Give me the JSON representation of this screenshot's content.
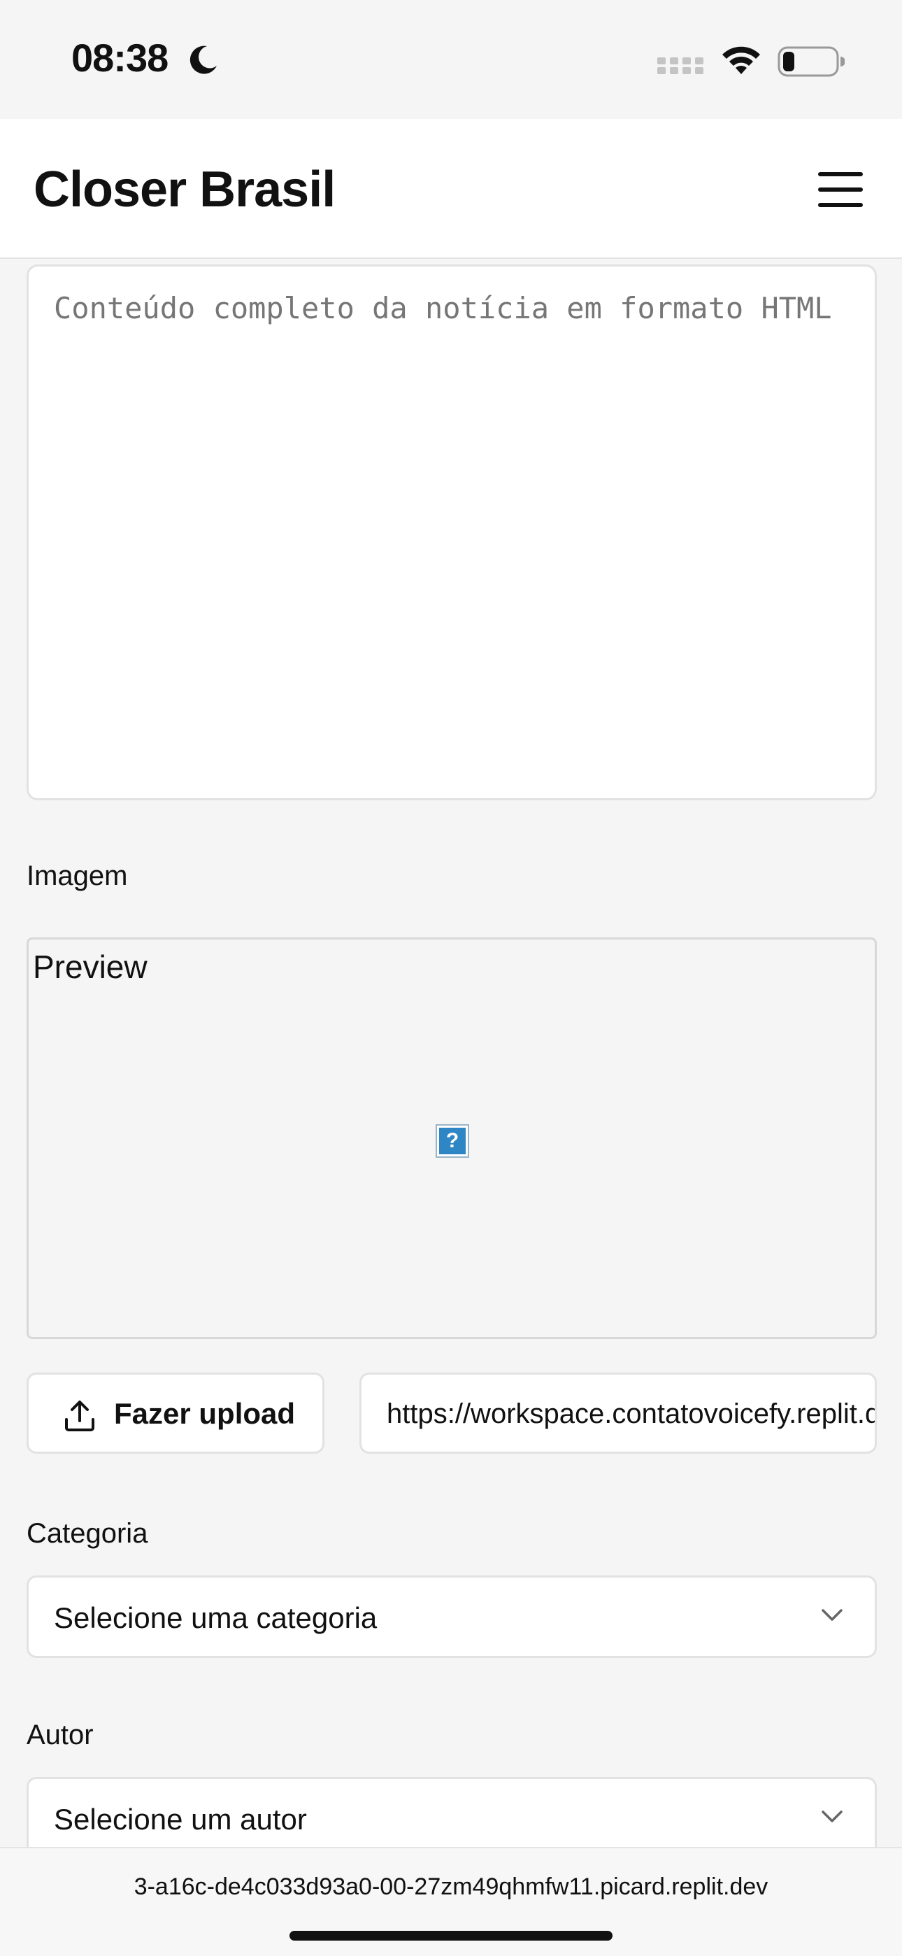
{
  "status": {
    "time": "08:38"
  },
  "header": {
    "title": "Closer Brasil"
  },
  "form": {
    "content_placeholder": "Conteúdo completo da notícia em formato HTML",
    "image_label": "Imagem",
    "preview_label": "Preview",
    "upload_label": "Fazer upload",
    "image_url": "https://workspace.contatovoicefy.replit.dev",
    "category_label": "Categoria",
    "category_value": "Selecione uma categoria",
    "author_label": "Autor",
    "author_value": "Selecione um autor"
  },
  "browser": {
    "url": "3-a16c-de4c033d93a0-00-27zm49qhmfw11.picard.replit.dev"
  },
  "colors": {
    "accent": "#2f86c5",
    "border": "#e2e2e2",
    "background": "#f5f5f5"
  },
  "icons": [
    "moon-icon",
    "cellular-signal-icon",
    "wifi-icon",
    "battery-icon",
    "hamburger-menu-icon",
    "broken-image-icon",
    "upload-icon",
    "chevron-down-icon"
  ]
}
